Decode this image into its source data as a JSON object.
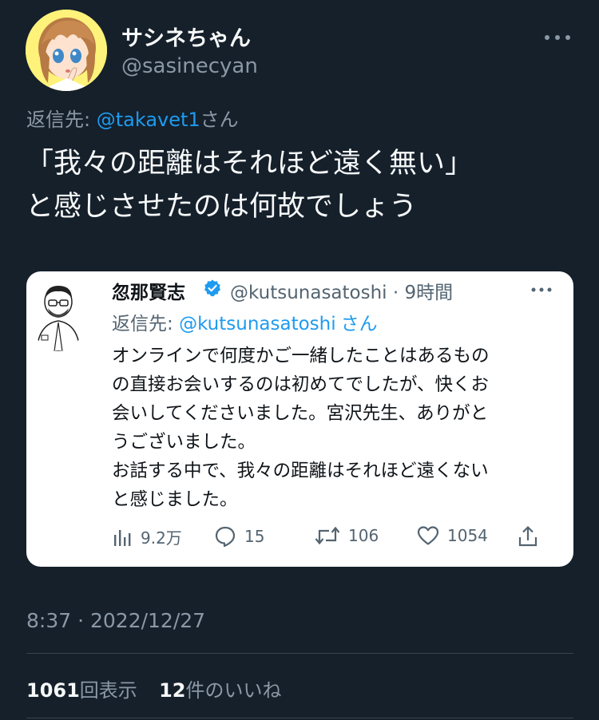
{
  "tweet": {
    "display_name": "サシネちゃん",
    "handle": "@sasinecyan",
    "more_icon": "more-dots-icon",
    "reply_prefix": "返信先: ",
    "reply_mention": "@takavet1",
    "reply_suffix": "さん",
    "text": "「我々の距離はそれほど遠く無い」\nと感じさせたのは何故でしょう",
    "timestamp": "8:37 · 2022/12/27",
    "views_count": "1061",
    "views_label": "回表示",
    "likes_count": "12",
    "likes_label": "件のいいね"
  },
  "quote": {
    "display_name": "忽那賢志",
    "verified_icon": "verified-badge-icon",
    "handle_time": "@kutsunasatoshi · 9時間",
    "reply_prefix": "返信先: ",
    "reply_mention": "@kutsunasatoshi",
    "reply_suffix": "さん",
    "text": "オンラインで何度かご一緒したことはあるもの\nの直接お会いするのは初めてでしたが、快くお\n会いしてくださいました。宮沢先生、ありがと\nうございました。\nお話する中で、我々の距離はそれほど遠くない\nと感じました。",
    "actions": {
      "views": "9.2万",
      "replies": "15",
      "retweets": "106",
      "likes": "1054"
    }
  },
  "colors": {
    "background": "#15202b",
    "link": "#1d9bf0",
    "secondary_text": "#8b98a5",
    "card_background": "#ffffff"
  }
}
